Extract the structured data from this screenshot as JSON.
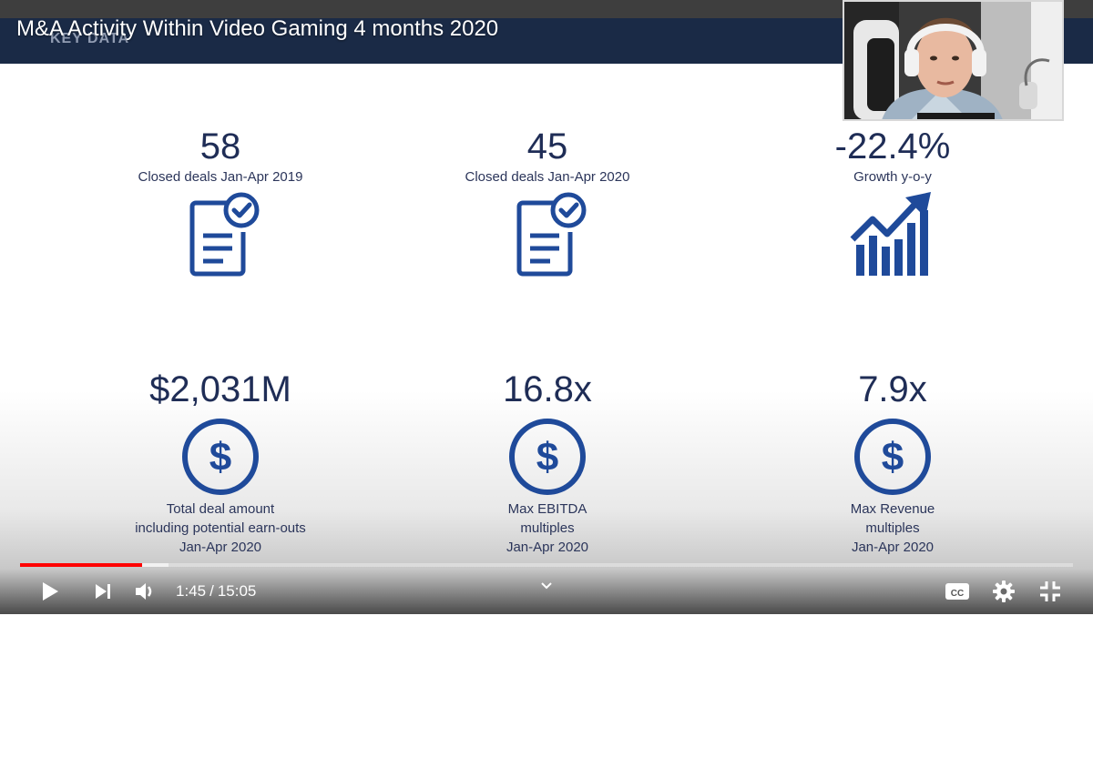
{
  "video": {
    "title": "M&A Activity Within Video Gaming 4 months 2020"
  },
  "slide": {
    "header": "KEY DATA",
    "stats": [
      {
        "value": "58",
        "label_lines": [
          "Closed deals Jan-Apr 2019"
        ],
        "icon": "document-check-icon"
      },
      {
        "value": "45",
        "label_lines": [
          "Closed deals Jan-Apr 2020"
        ],
        "icon": "document-check-icon"
      },
      {
        "value": "-22.4%",
        "label_lines": [
          "Growth y-o-y"
        ],
        "icon": "growth-chart-icon"
      },
      {
        "value": "$2,031M",
        "label_lines": [
          "Total deal amount",
          "including potential earn-outs",
          "Jan-Apr 2020"
        ],
        "icon": "dollar-circle-icon"
      },
      {
        "value": "16.8x",
        "label_lines": [
          "Max EBITDA",
          "multiples",
          "Jan-Apr 2020"
        ],
        "icon": "dollar-circle-icon"
      },
      {
        "value": "7.9x",
        "label_lines": [
          "Max Revenue",
          "multiples",
          "Jan-Apr 2020"
        ],
        "icon": "dollar-circle-icon"
      }
    ]
  },
  "player": {
    "current_time": "1:45",
    "duration": "15:05",
    "progress_fraction": 0.116,
    "buffered_fraction": 0.141,
    "colors": {
      "progress": "#ff0000",
      "slide_text": "#1f2d56",
      "icon": "#1f4a9a",
      "title_bar": "#1a2a46"
    },
    "icons": [
      "play-icon",
      "next-icon",
      "volume-icon",
      "chevron-down-icon",
      "captions-icon",
      "settings-icon",
      "exit-fullscreen-icon"
    ]
  }
}
